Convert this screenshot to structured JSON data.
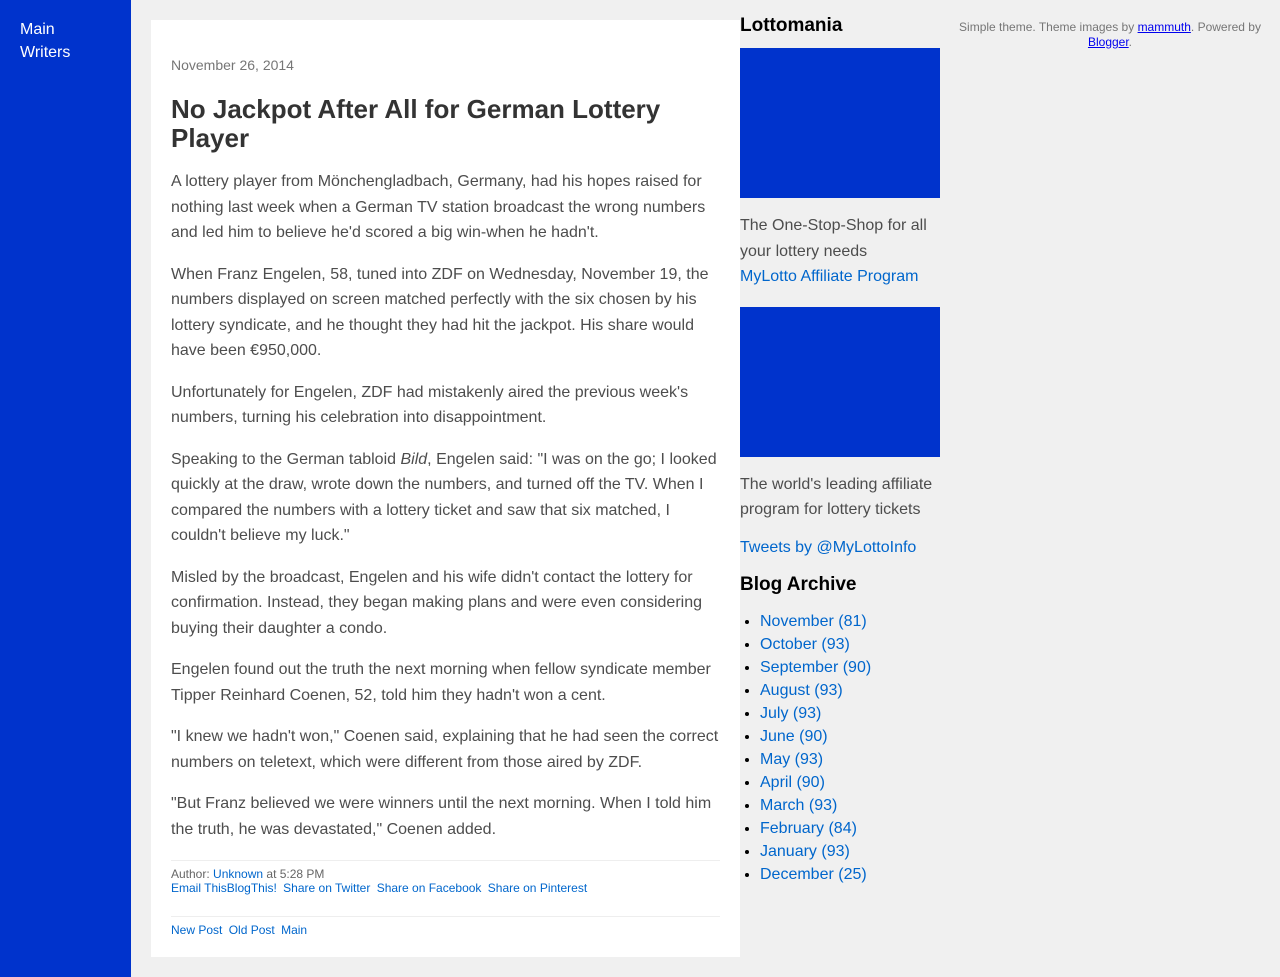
{
  "nav": {
    "main": "Main",
    "writers": "Writers"
  },
  "post": {
    "date": "November 26, 2014",
    "title": "No Jackpot After All for German Lottery Player",
    "p1": "A lottery player from Mönchengladbach, Germany, had his hopes raised for nothing last week when a German TV station broadcast the wrong numbers and led him to believe he'd scored a big win-when he hadn't.",
    "p2": "When Franz Engelen, 58, tuned into ZDF on Wednesday, November 19, the numbers displayed on screen matched perfectly with the six chosen by his lottery syndicate, and he thought they had hit the jackpot. His share would have been €950,000.",
    "p3": "Unfortunately for Engelen, ZDF had mistakenly aired the previous week's numbers, turning his celebration into disappointment.",
    "p4_before": "Speaking to the German tabloid ",
    "p4_em": "Bild",
    "p4_after": ", Engelen said: \"I was on the go; I looked quickly at the draw, wrote down the numbers, and turned off the TV. When I compared the numbers with a lottery ticket and saw that six matched, I couldn't believe my luck.\"",
    "p5": "Misled by the broadcast, Engelen and his wife didn't contact the lottery for confirmation. Instead, they began making plans and were even considering buying their daughter a condo.",
    "p6": "Engelen found out the truth the next morning when fellow syndicate member Tipper Reinhard Coenen, 52, told him they hadn't won a cent.",
    "p7": "\"I knew we hadn't won,\" Coenen said, explaining that he had seen the correct numbers on teletext, which were different from those aired by ZDF.",
    "p8": "\"But Franz believed we were winners until the next morning. When I told him the truth, he was devastated,\" Coenen added.",
    "author_label": "Author: ",
    "author": "Unknown",
    "time_text": " at 5:28 PM",
    "share": {
      "email": "Email This",
      "blogthis": "BlogThis!",
      "twitter": "Share on Twitter",
      "facebook": "Share on Facebook",
      "pinterest": "Share on Pinterest"
    },
    "pager": {
      "newer": "New Post",
      "older": "Old Post",
      "home": "Main"
    }
  },
  "sidebar": {
    "title": "Lottomania",
    "banner1_text": "The One-Stop-Shop for all your lottery needs",
    "affiliate_link": "MyLotto Affiliate Program",
    "banner2_text": "The world's leading affiliate program for lottery tickets",
    "tweets_link": "Tweets by @MyLottoInfo",
    "archive_title": "Blog Archive",
    "archive": [
      "November (81)",
      "October (93)",
      "September (90)",
      "August (93)",
      "July (93)",
      "June (90)",
      "May (93)",
      "April (90)",
      "March (93)",
      "February (84)",
      "January (93)",
      "December (25)"
    ]
  },
  "attribution": {
    "prefix": "Simple theme. Theme images by ",
    "author": "mammuth",
    "middle": ". Powered by ",
    "platform": "Blogger",
    "suffix": "."
  },
  "colors": {
    "brand_blue": "#0033cc",
    "link": "#0066cc",
    "background": "#f0f0f0"
  }
}
